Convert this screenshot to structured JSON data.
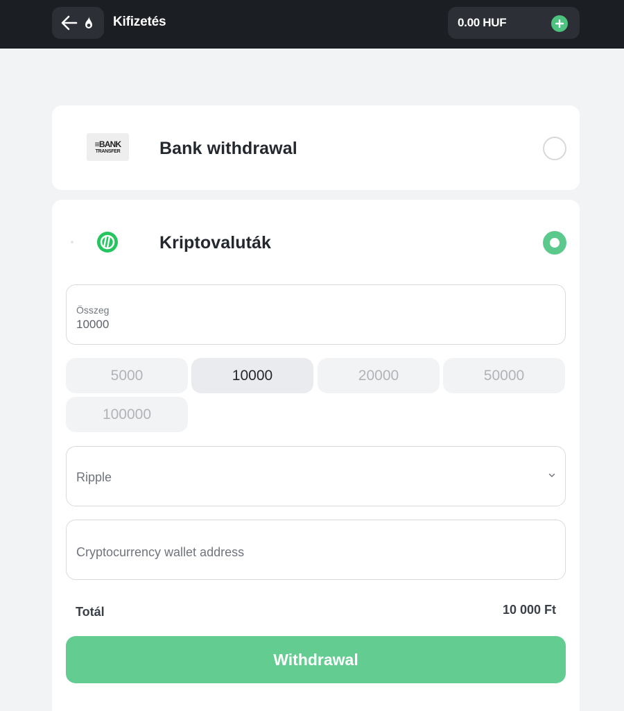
{
  "header": {
    "title": "Kifizetés",
    "back_icon": "arrow-left-icon",
    "logo_icon": "flame-icon",
    "balance": "0.00 HUF",
    "add_funds_icon": "plus-icon"
  },
  "methods": {
    "bank": {
      "logo_line1": "≡BANK",
      "logo_line2": "TRANSFER",
      "label": "Bank withdrawal",
      "selected": false
    },
    "crypto": {
      "icon": "crypto-coin-icon",
      "label": "Kriptovaluták",
      "selected": true
    }
  },
  "form": {
    "amount_label": "Összeg",
    "amount_value": "10000",
    "quick_amounts": [
      "5000",
      "10000",
      "20000",
      "50000",
      "100000"
    ],
    "quick_amount_selected": "10000",
    "currency_selected": "Ripple",
    "wallet_placeholder": "Cryptocurrency wallet address",
    "total_label": "Totál",
    "total_value": "10 000 Ft",
    "submit_label": "Withdrawal"
  },
  "colors": {
    "accent_green": "#63cc91",
    "header_bg": "#1b1e22",
    "page_bg": "#f2f3f5"
  }
}
